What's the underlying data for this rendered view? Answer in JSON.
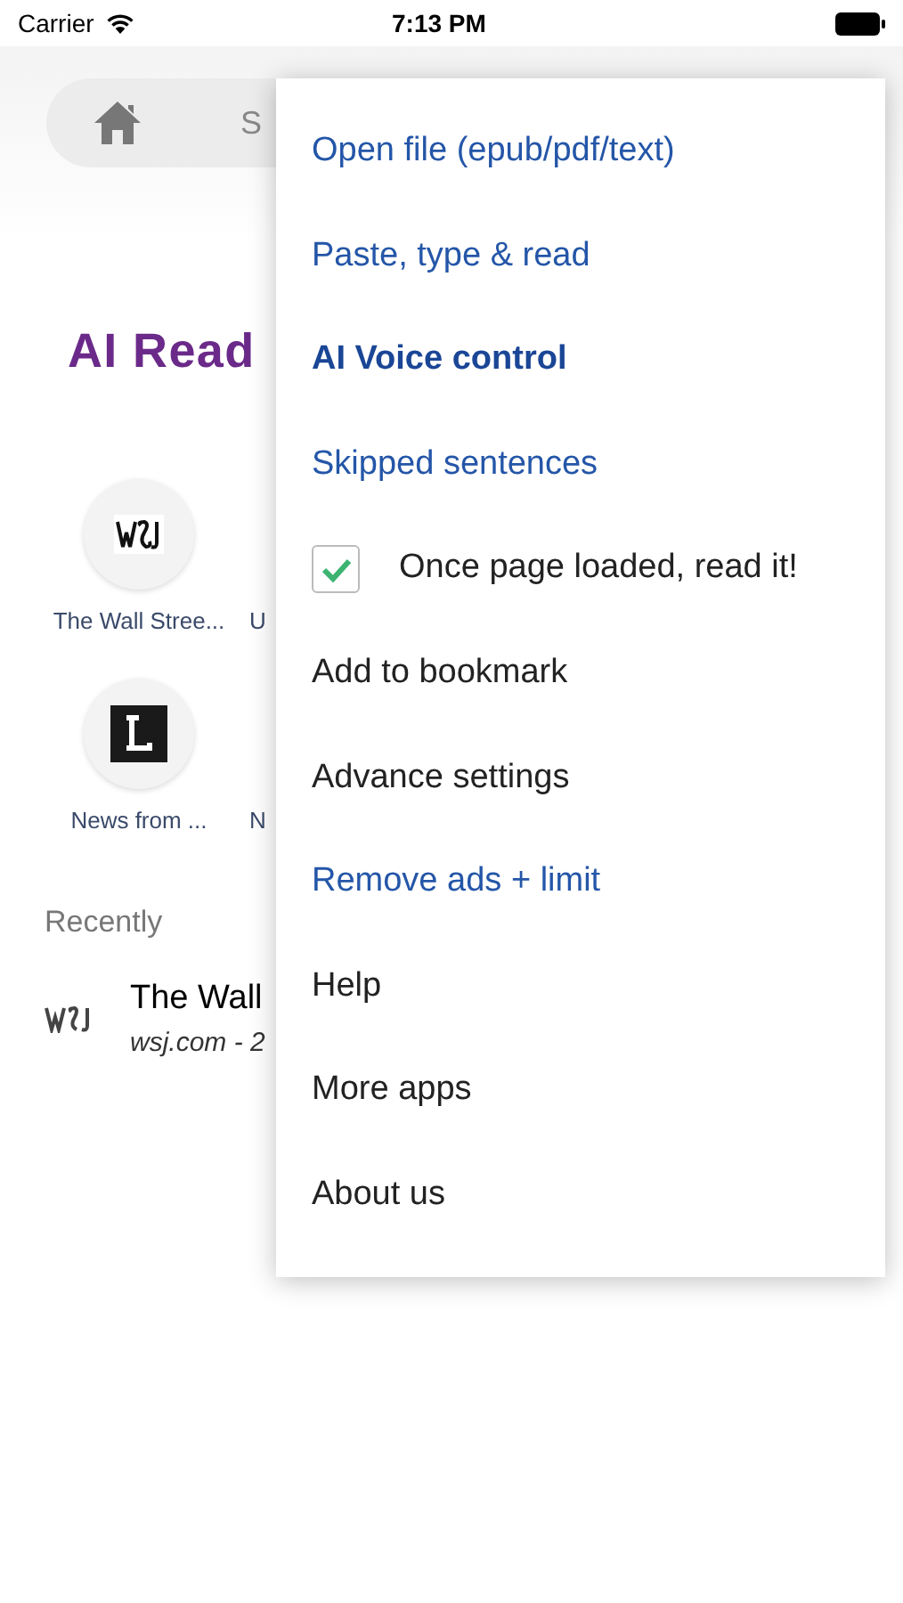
{
  "status_bar": {
    "carrier": "Carrier",
    "time": "7:13 PM"
  },
  "search": {
    "placeholder": "S"
  },
  "logo": "AI Read",
  "shortcuts": [
    {
      "label": "The Wall Stree...",
      "kind": "wsj"
    },
    {
      "label": "U",
      "kind": "none"
    },
    {
      "label": "News from ...",
      "kind": "l"
    },
    {
      "label": "N",
      "kind": "none"
    }
  ],
  "recently": {
    "heading": "Recently",
    "items": [
      {
        "title": "The Wall",
        "subtitle": "wsj.com - 2"
      }
    ]
  },
  "menu": {
    "items": [
      {
        "label": "Open file (epub/pdf/text)",
        "kind": "link"
      },
      {
        "label": "Paste, type & read",
        "kind": "link"
      },
      {
        "label": "AI Voice control",
        "kind": "bold-link"
      },
      {
        "label": "Skipped sentences",
        "kind": "link"
      },
      {
        "label": "Once page loaded, read it!",
        "kind": "checkbox",
        "checked": true
      },
      {
        "label": "Add to bookmark",
        "kind": "plain"
      },
      {
        "label": "Advance settings",
        "kind": "plain"
      },
      {
        "label": "Remove ads + limit",
        "kind": "link"
      },
      {
        "label": "Help",
        "kind": "plain"
      },
      {
        "label": "More apps",
        "kind": "plain"
      },
      {
        "label": "About us",
        "kind": "plain"
      }
    ]
  }
}
